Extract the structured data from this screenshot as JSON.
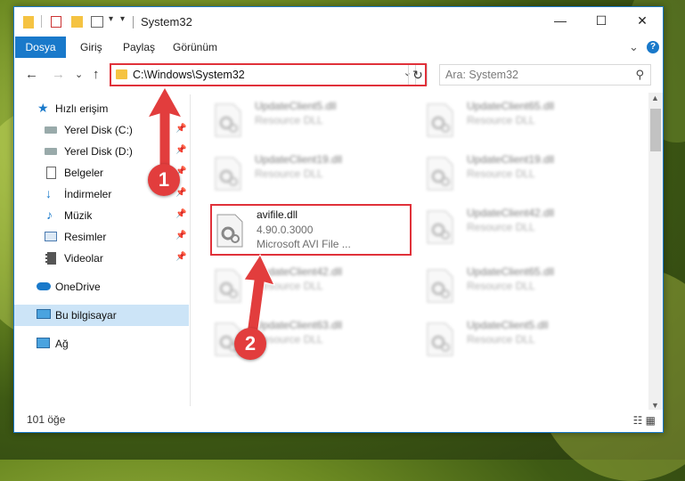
{
  "window": {
    "title": "System32",
    "controls": {
      "minimize": "—",
      "maximize": "☐",
      "close": "✕"
    }
  },
  "ribbon": {
    "tabs": [
      "Dosya",
      "Giriş",
      "Paylaş",
      "Görünüm"
    ],
    "chevron": "⌄",
    "help": "?"
  },
  "navbar": {
    "back": "←",
    "forward": "→",
    "recent": "⌄",
    "up": "↑",
    "address": "C:\\Windows\\System32",
    "address_dropdown": "⌄",
    "refresh": "↻",
    "search_placeholder": "Ara: System32",
    "search_icon": "⚲"
  },
  "sidebar": {
    "quick_access": "Hızlı erişim",
    "items": [
      {
        "label": "Yerel Disk (C:)",
        "icon": "drive-icon"
      },
      {
        "label": "Yerel Disk (D:)",
        "icon": "drive-icon"
      },
      {
        "label": "Belgeler",
        "icon": "documents-icon"
      },
      {
        "label": "İndirmeler",
        "icon": "downloads-icon"
      },
      {
        "label": "Müzik",
        "icon": "music-icon"
      },
      {
        "label": "Resimler",
        "icon": "pictures-icon"
      },
      {
        "label": "Videolar",
        "icon": "videos-icon"
      }
    ],
    "onedrive": "OneDrive",
    "this_pc": "Bu bilgisayar",
    "network": "Ağ",
    "pin": "📌"
  },
  "files": {
    "col1": [
      {
        "name": "UpdateClient5.dll",
        "sub1": "Resource DLL",
        "sub2": ""
      },
      {
        "name": "UpdateClient19.dll",
        "sub1": "Resource DLL",
        "sub2": ""
      },
      {
        "name": "avifile.dll",
        "sub1": "4.90.0.3000",
        "sub2": "Microsoft AVI File ..."
      },
      {
        "name": "UpdateClient42.dll",
        "sub1": "Resource DLL",
        "sub2": ""
      },
      {
        "name": "UpdateClient63.dll",
        "sub1": "Resource DLL",
        "sub2": ""
      }
    ],
    "col2": [
      {
        "name": "UpdateClient65.dll",
        "sub1": "Resource DLL",
        "sub2": ""
      },
      {
        "name": "UpdateClient19.dll",
        "sub1": "Resource DLL",
        "sub2": ""
      },
      {
        "name": "UpdateClient42.dll",
        "sub1": "Resource DLL",
        "sub2": ""
      },
      {
        "name": "UpdateClient65.dll",
        "sub1": "Resource DLL",
        "sub2": ""
      },
      {
        "name": "UpdateClient5.dll",
        "sub1": "Resource DLL",
        "sub2": ""
      }
    ]
  },
  "status": {
    "count": "101 öğe",
    "view_icons": "☷ ▦"
  },
  "annotations": {
    "step1": "1",
    "step2": "2"
  },
  "colors": {
    "accent": "#1979ca",
    "annotation_red": "#e0313a"
  }
}
